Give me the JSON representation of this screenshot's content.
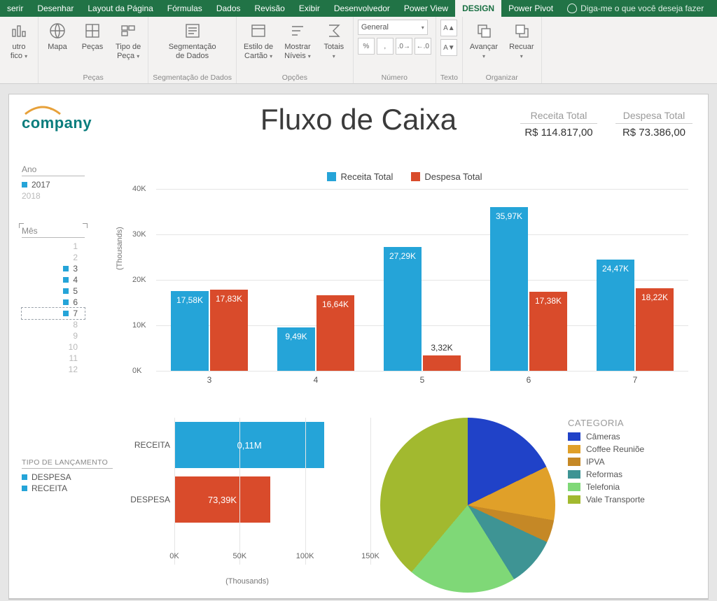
{
  "tabs": {
    "items": [
      "serir",
      "Desenhar",
      "Layout da Página",
      "Fórmulas",
      "Dados",
      "Revisão",
      "Exibir",
      "Desenvolvedor",
      "Power View",
      "DESIGN",
      "Power Pivot"
    ],
    "active_index": 9,
    "tell_me": "Diga-me o que você deseja fazer"
  },
  "ribbon": {
    "groups": [
      {
        "name": "",
        "controls": [
          {
            "label": "utro\nfico",
            "dd": true
          }
        ]
      },
      {
        "name": "Peças",
        "controls": [
          {
            "label": "Mapa"
          },
          {
            "label": "Peças"
          },
          {
            "label": "Tipo de\nPeça",
            "dd": true
          }
        ]
      },
      {
        "name": "Segmentação de Dados",
        "controls": [
          {
            "label": "Segmentação\nde Dados"
          }
        ]
      },
      {
        "name": "Opções",
        "controls": [
          {
            "label": "Estilo de\nCartão",
            "dd": true
          },
          {
            "label": "Mostrar\nNíveis",
            "dd": true
          },
          {
            "label": "Totais",
            "dd": true
          }
        ]
      },
      {
        "name": "Número",
        "format_value": "General"
      },
      {
        "name": "Texto",
        "controls": [
          {
            "label": ""
          },
          {
            "label": ""
          }
        ],
        "font_buttons": true
      },
      {
        "name": "Organizar",
        "controls": [
          {
            "label": "Avançar",
            "dd": true
          },
          {
            "label": "Recuar",
            "dd": true
          }
        ]
      }
    ]
  },
  "dashboard": {
    "logo_text": "company",
    "title": "Fluxo de Caixa",
    "totals": [
      {
        "label": "Receita Total",
        "value": "R$ 114.817,00"
      },
      {
        "label": "Despesa Total",
        "value": "R$ 73.386,00"
      }
    ],
    "slicer_year": {
      "title": "Ano",
      "items": [
        {
          "v": "2017",
          "sel": true
        },
        {
          "v": "2018",
          "sel": false
        }
      ]
    },
    "slicer_month": {
      "title": "Mês",
      "items": [
        {
          "v": "1",
          "sel": false
        },
        {
          "v": "2",
          "sel": false
        },
        {
          "v": "3",
          "sel": true
        },
        {
          "v": "4",
          "sel": true
        },
        {
          "v": "5",
          "sel": true
        },
        {
          "v": "6",
          "sel": true
        },
        {
          "v": "7",
          "sel": true
        },
        {
          "v": "8",
          "sel": false
        },
        {
          "v": "9",
          "sel": false
        },
        {
          "v": "10",
          "sel": false
        },
        {
          "v": "11",
          "sel": false
        },
        {
          "v": "12",
          "sel": false
        }
      ]
    },
    "slicer_tipo": {
      "title": "TIPO DE LANÇAMENTO",
      "items": [
        {
          "v": "DESPESA"
        },
        {
          "v": "RECEITA"
        }
      ]
    },
    "legend_main": [
      {
        "label": "Receita Total",
        "color": "#25a4d8"
      },
      {
        "label": "Despesa Total",
        "color": "#d94b2b"
      }
    ],
    "pie_legend": {
      "title": "CATEGORIA",
      "items": [
        {
          "label": "Câmeras",
          "color": "#2042c8"
        },
        {
          "label": "Coffee Reuniõe",
          "color": "#e0a029"
        },
        {
          "label": "IPVA",
          "color": "#c58826"
        },
        {
          "label": "Reformas",
          "color": "#3e9494"
        },
        {
          "label": "Telefonia",
          "color": "#7fd877"
        },
        {
          "label": "Vale Transporte",
          "color": "#a2b92f"
        }
      ]
    }
  },
  "chart_data": [
    {
      "type": "bar",
      "title": "",
      "xlabel": "",
      "ylabel": "(Thousands)",
      "ylim": [
        0,
        40
      ],
      "yticks": [
        0,
        10,
        20,
        30,
        40
      ],
      "ytick_labels": [
        "0K",
        "10K",
        "20K",
        "30K",
        "40K"
      ],
      "categories": [
        "3",
        "4",
        "5",
        "6",
        "7"
      ],
      "series": [
        {
          "name": "Receita Total",
          "color": "#25a4d8",
          "values": [
            17.58,
            9.49,
            27.29,
            35.97,
            24.47
          ],
          "labels": [
            "17,58K",
            "9,49K",
            "27,29K",
            "35,97K",
            "24,47K"
          ]
        },
        {
          "name": "Despesa Total",
          "color": "#d94b2b",
          "values": [
            17.83,
            16.64,
            3.32,
            17.38,
            18.22
          ],
          "labels": [
            "17,83K",
            "16,64K",
            "3,32K",
            "17,38K",
            "18,22K"
          ]
        }
      ]
    },
    {
      "type": "bar_horizontal",
      "xlabel": "(Thousands)",
      "xlim": [
        0,
        150
      ],
      "xticks": [
        0,
        50,
        100,
        150
      ],
      "xtick_labels": [
        "0K",
        "50K",
        "100K",
        "150K"
      ],
      "categories": [
        "RECEITA",
        "DESPESA"
      ],
      "values": [
        114.817,
        73.39
      ],
      "colors": [
        "#25a4d8",
        "#d94b2b"
      ],
      "labels": [
        "0,11M",
        "73,39K"
      ]
    },
    {
      "type": "pie",
      "title": "CATEGORIA",
      "series": [
        {
          "name": "Câmeras",
          "color": "#2042c8",
          "value": 18
        },
        {
          "name": "Coffee Reuniões",
          "color": "#e0a029",
          "value": 10
        },
        {
          "name": "IPVA",
          "color": "#c58826",
          "value": 4
        },
        {
          "name": "Reformas",
          "color": "#3e9494",
          "value": 9
        },
        {
          "name": "Telefonia",
          "color": "#7fd877",
          "value": 20
        },
        {
          "name": "Vale Transporte",
          "color": "#a2b92f",
          "value": 39
        }
      ]
    }
  ]
}
